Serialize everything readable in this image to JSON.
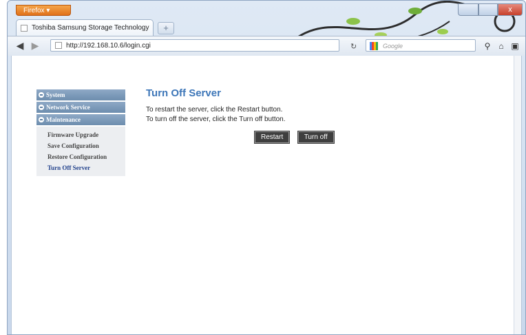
{
  "browser": {
    "menu_button": "Firefox",
    "tab_title": "Toshiba Samsung Storage Technology",
    "new_tab": "+",
    "url": "http://192.168.10.6/login.cgi",
    "search_placeholder": "Google",
    "close_glyph": "x"
  },
  "sidebar": {
    "sections": [
      "System",
      "Network Service",
      "Maintenance"
    ],
    "items": [
      "Firmware Upgrade",
      "Save Configuration",
      "Restore Configuration",
      "Turn Off Server"
    ]
  },
  "main": {
    "title": "Turn Off Server",
    "line1": "To restart the server, click the Restart button.",
    "line2": "To turn off the server, click the Turn off button.",
    "restart_label": "Restart",
    "turnoff_label": "Turn off"
  }
}
